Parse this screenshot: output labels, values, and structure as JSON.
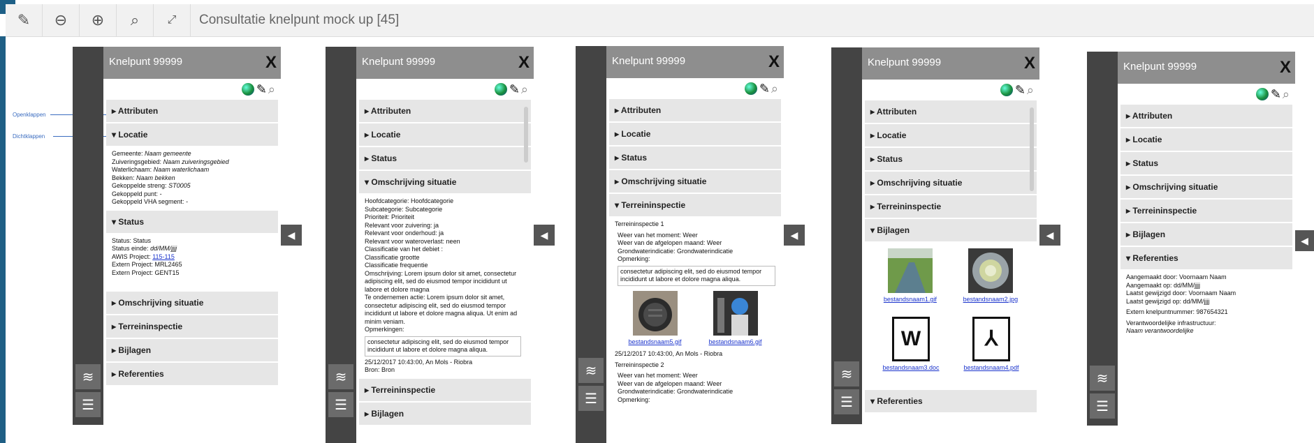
{
  "toolbar": {
    "title": "Consultatie knelpunt mock up [45]",
    "icons": [
      "pencil-icon",
      "zoom-out-icon",
      "zoom-in-icon",
      "search-icon",
      "fullscreen-icon"
    ]
  },
  "panel_title": "Knelpunt 99999",
  "close_label": "X",
  "annotations": {
    "open": "Openklappen",
    "close": "Dichtklappen"
  },
  "sections": {
    "attributen": "Attributen",
    "locatie": "Locatie",
    "status": "Status",
    "omschrijving": "Omschrijving situatie",
    "terreininspectie": "Terreininspectie",
    "bijlagen": "Bijlagen",
    "referenties": "Referenties"
  },
  "locatie": {
    "gemeente_label": "Gemeente:",
    "gemeente": "Naam gemeente",
    "zuivering_label": "Zuiveringsgebied:",
    "zuivering": "Naam zuiveringsgebied",
    "waterlichaam_label": "Waterlichaam:",
    "waterlichaam": "Naam waterlichaam",
    "bekken_label": "Bekken:",
    "bekken": "Naam bekken",
    "streng_label": "Gekoppelde streng:",
    "streng": "ST0005",
    "punt_label": "Gekoppeld punt:",
    "punt": "-",
    "vha_label": "Gekoppeld VHA segment:",
    "vha": "-"
  },
  "status": {
    "status_label": "Status:",
    "status": "Status",
    "einde_label": "Status einde:",
    "einde": "dd/MM/jjjj",
    "awis_label": "AWIS Project:",
    "awis": "115-115",
    "extern1_label": "Extern Project:",
    "extern1": "MRL2465",
    "extern2_label": "Extern Project:",
    "extern2": "GENT15"
  },
  "omschrijving": {
    "lines": [
      "Hoofdcategorie: Hoofdcategorie",
      "Subcategorie: Subcategorie",
      "Prioriteit: Prioriteit",
      "Relevant voor zuivering: ja",
      "Relevant voor onderhoud: ja",
      "Relevant voor wateroverlast: neen",
      "Classificatie van het debiet :",
      "Classificatie grootte",
      "Classificatie frequentie",
      "Omschrijving: Lorem ipsum dolor sit amet, consectetur adipiscing elit, sed do eiusmod tempor incididunt ut labore et dolore magna",
      "Te ondernemen actie: Lorem ipsum dolor sit amet, consectetur adipiscing elit, sed do eiusmod tempor incididunt ut labore et dolore magna aliqua. Ut enim ad minim veniam.",
      "Opmerkingen:"
    ],
    "remark": "consectetur adipiscing elit, sed do eiusmod tempor incididunt ut labore et dolore magna aliqua.",
    "stamp": "25/12/2017 10:43:00, An Mols - Riobra",
    "bron": "Bron: Bron"
  },
  "terreininspectie": {
    "title1": "Terreininspectie 1",
    "weer_nu": "Weer van het moment: Weer",
    "weer_maand": "Weer van de afgelopen maand: Weer",
    "grondwater": "Grondwaterindicatie: Grondwaterindicatie",
    "opmerking_label": "Opmerking:",
    "remark": "consectetur adipiscing elit, sed do eiusmod tempor incididunt ut labore et dolore magna aliqua.",
    "file1": "bestandsnaam5.gif",
    "file2": "bestandsnaam6.gif",
    "stamp": "25/12/2017 10:43:00, An Mols - Riobra",
    "title2": "Terreininspectie 2"
  },
  "bijlagen": {
    "file1": "bestandsnaam1.gif",
    "file2": "bestandsnaam2.jpg",
    "file3": "bestandsnaam3.doc",
    "file4": "bestandsnaam4.pdf",
    "doc_letter": "W",
    "pdf_letter": "⅄"
  },
  "referenties": {
    "aangemaakt_door": "Aangemaakt door: Voornaam Naam",
    "aangemaakt_op": "Aangemaakt op: dd/MM/jjjj",
    "gewijzigd_door": "Laatst gewijzigd door: Voornaam Naam",
    "gewijzigd_op": "Laatst gewijzigd op: dd/MM/jjjj",
    "extern": "Extern knelpuntnummer: 987654321",
    "verantw": "Verantwoordelijke infrastructuur:",
    "verantw_naam": "Naam verantwoordelijke"
  }
}
